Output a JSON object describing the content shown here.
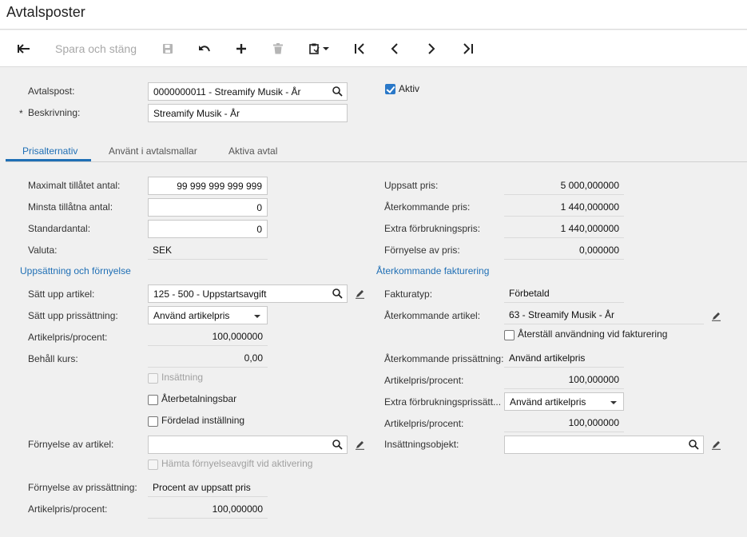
{
  "window": {
    "title": "Avtalsposter"
  },
  "toolbar": {
    "back_icon": "back-arrow-icon",
    "save_close_label": "Spara och stäng",
    "save_icon": "save-icon",
    "undo_icon": "undo-icon",
    "add_icon": "plus-icon",
    "delete_icon": "trash-icon",
    "clipboard_icon": "clipboard-icon",
    "first_icon": "first-record-icon",
    "prev_icon": "chevron-left-icon",
    "next_icon": "chevron-right-icon",
    "last_icon": "last-record-icon"
  },
  "header": {
    "contract_item_label": "Avtalspost:",
    "contract_item_value": "0000000011 - Streamify Musik - År",
    "description_label": "Beskrivning:",
    "description_value": "Streamify Musik - År",
    "required_mark": "*",
    "active_label": "Aktiv",
    "active_checked": true
  },
  "tabs": [
    {
      "label": "Prisalternativ",
      "active": true
    },
    {
      "label": "Använt i avtalsmallar",
      "active": false
    },
    {
      "label": "Aktiva avtal",
      "active": false
    }
  ],
  "left": {
    "max_qty_label": "Maximalt tillåtet antal:",
    "max_qty_value": "99 999 999 999 999",
    "min_qty_label": "Minsta tillåtna antal:",
    "min_qty_value": "0",
    "default_qty_label": "Standardantal:",
    "default_qty_value": "0",
    "currency_label": "Valuta:",
    "currency_value": "SEK",
    "setup_section": "Uppsättning och förnyelse",
    "setup_item_label": "Sätt upp artikel:",
    "setup_item_value": "125 - 500 - Uppstartsavgift",
    "setup_pricing_label": "Sätt upp prissättning:",
    "setup_pricing_value": "Använd artikelpris",
    "item_price_pct_label": "Artikelpris/procent:",
    "item_price_pct_value": "100,000000",
    "keep_rate_label": "Behåll kurs:",
    "keep_rate_value": "0,00",
    "deposit_label": "Insättning",
    "refundable_label": "Återbetalningsbar",
    "prorated_label": "Fördelad inställning",
    "renewal_item_label": "Förnyelse av artikel:",
    "renewal_item_value": "",
    "renewal_fee_label": "Hämta förnyelseavgift vid aktivering",
    "renewal_pricing_label": "Förnyelse av prissättning:",
    "renewal_pricing_value": "Procent av uppsatt pris",
    "renewal_pct_label": "Artikelpris/procent:",
    "renewal_pct_value": "100,000000"
  },
  "right": {
    "setup_price_label": "Uppsatt pris:",
    "setup_price_value": "5 000,000000",
    "recurring_price_label": "Återkommande pris:",
    "recurring_price_value": "1 440,000000",
    "extra_usage_price_label": "Extra förbrukningspris:",
    "extra_usage_price_value": "1 440,000000",
    "renewal_price_label": "Förnyelse av pris:",
    "renewal_price_value": "0,000000",
    "billing_section": "Återkommande fakturering",
    "invoice_type_label": "Fakturatyp:",
    "invoice_type_value": "Förbetald",
    "recurring_item_label": "Återkommande artikel:",
    "recurring_item_value": "63 - Streamify Musik - År",
    "reset_usage_label": "Återställ användning vid fakturering",
    "recurring_pricing_label": "Återkommande prissättning:",
    "recurring_pricing_value": "Använd artikelpris",
    "recurring_pct_label": "Artikelpris/procent:",
    "recurring_pct_value": "100,000000",
    "extra_usage_pricing_label": "Extra förbrukningsprissätt...",
    "extra_usage_pricing_value": "Använd artikelpris",
    "extra_pct_label": "Artikelpris/procent:",
    "extra_pct_value": "100,000000",
    "deposit_object_label": "Insättningsobjekt:",
    "deposit_object_value": ""
  }
}
